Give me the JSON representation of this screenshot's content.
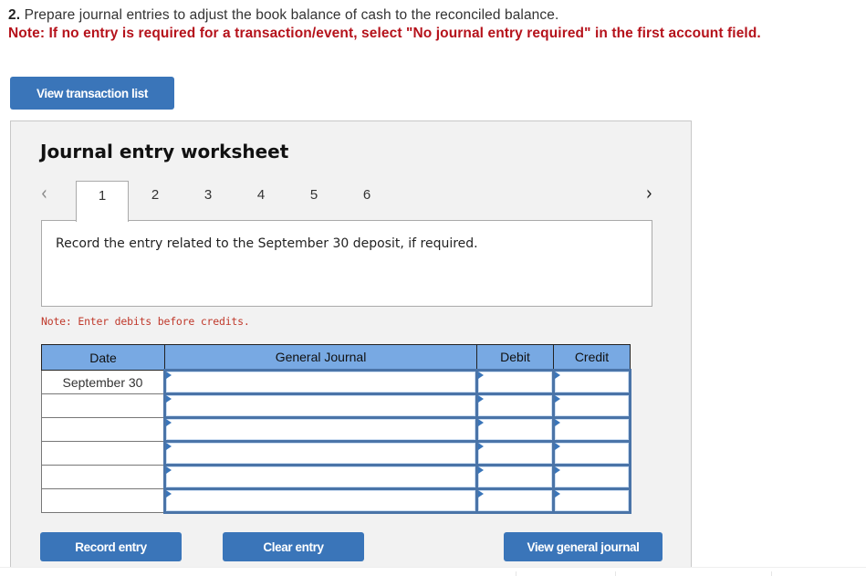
{
  "question": {
    "number": "2.",
    "text": "Prepare journal entries to adjust the book balance of cash to the reconciled balance.",
    "note": "Note: If no entry is required for a transaction/event, select \"No journal entry required\" in the first account field."
  },
  "buttons": {
    "view_transaction_list": "View transaction list",
    "record_entry": "Record entry",
    "clear_entry": "Clear entry",
    "view_general_journal": "View general journal"
  },
  "worksheet": {
    "title": "Journal entry worksheet",
    "nav_prev_icon": "‹",
    "nav_next_icon": "›",
    "tabs": [
      {
        "label": "1",
        "active": true
      },
      {
        "label": "2",
        "active": false
      },
      {
        "label": "3",
        "active": false
      },
      {
        "label": "4",
        "active": false
      },
      {
        "label": "5",
        "active": false
      },
      {
        "label": "6",
        "active": false
      }
    ],
    "prompt": "Record the entry related to the September 30 deposit, if required.",
    "note": "Note: Enter debits before credits."
  },
  "journal": {
    "columns": [
      "Date",
      "General Journal",
      "Debit",
      "Credit"
    ],
    "rows": [
      {
        "date": "September 30",
        "account": "",
        "debit": "",
        "credit": ""
      },
      {
        "date": "",
        "account": "",
        "debit": "",
        "credit": ""
      },
      {
        "date": "",
        "account": "",
        "debit": "",
        "credit": ""
      },
      {
        "date": "",
        "account": "",
        "debit": "",
        "credit": ""
      },
      {
        "date": "",
        "account": "",
        "debit": "",
        "credit": ""
      },
      {
        "date": "",
        "account": "",
        "debit": "",
        "credit": ""
      }
    ]
  },
  "colors": {
    "primary_button": "#3a75b9",
    "note_red": "#b5121b",
    "table_header": "#78a9e3",
    "input_border": "#4a74a8"
  }
}
